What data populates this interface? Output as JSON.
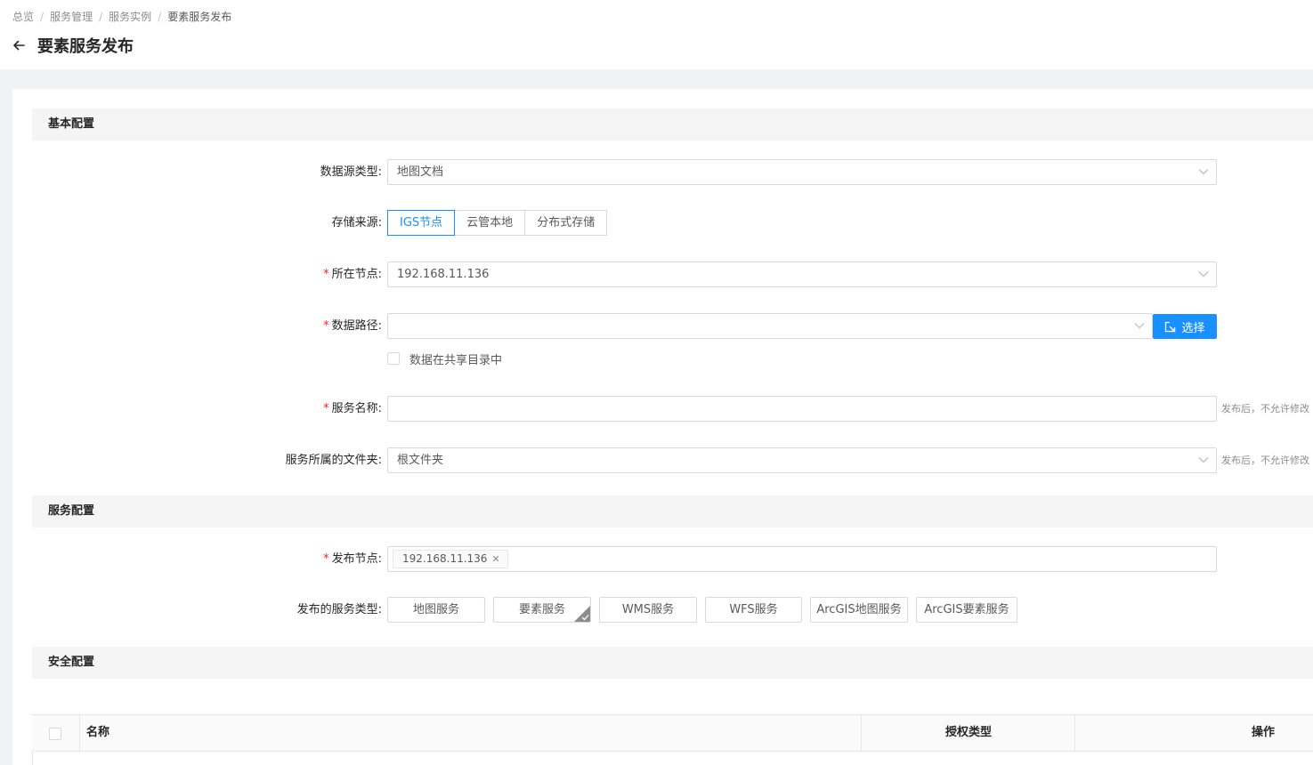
{
  "breadcrumb": [
    "总览",
    "服务管理",
    "服务实例",
    "要素服务发布"
  ],
  "breadcrumb_separator": "/",
  "page_title": "要素服务发布",
  "sections": {
    "basic": "基本配置",
    "service": "服务配置",
    "security": "安全配置"
  },
  "form": {
    "datasource_type": {
      "label": "数据源类型:",
      "value": "地图文档"
    },
    "storage_source": {
      "label": "存储来源:",
      "options": [
        "IGS节点",
        "云管本地",
        "分布式存储"
      ],
      "selected": "IGS节点"
    },
    "node": {
      "label": "所在节点:",
      "required": true,
      "value": "192.168.11.136"
    },
    "data_path": {
      "label": "数据路径:",
      "required": true,
      "value": "",
      "choose_label": "选择"
    },
    "shared_dir": {
      "label": "数据在共享目录中",
      "checked": false
    },
    "service_name": {
      "label": "服务名称:",
      "required": true,
      "value": "",
      "help": "发布后，不允许修改"
    },
    "folder": {
      "label": "服务所属的文件夹:",
      "value": "根文件夹",
      "help": "发布后，不允许修改"
    },
    "publish_node": {
      "label": "发布节点:",
      "required": true,
      "tags": [
        "192.168.11.136"
      ]
    },
    "service_types": {
      "label": "发布的服务类型:",
      "options": [
        "地图服务",
        "要素服务",
        "WMS服务",
        "WFS服务",
        "ArcGIS地图服务",
        "ArcGIS要素服务"
      ],
      "selected": "要素服务"
    }
  },
  "table": {
    "columns": [
      "名称",
      "授权类型",
      "操作"
    ]
  },
  "colors": {
    "primary": "#1890ff",
    "required": "#f5222d",
    "section_bg": "#f5f5f5"
  },
  "required_mark": "*",
  "icons": [
    "back-arrow-icon",
    "chevron-down-icon",
    "select-file-icon",
    "close-icon",
    "checkmark-corner-icon"
  ]
}
